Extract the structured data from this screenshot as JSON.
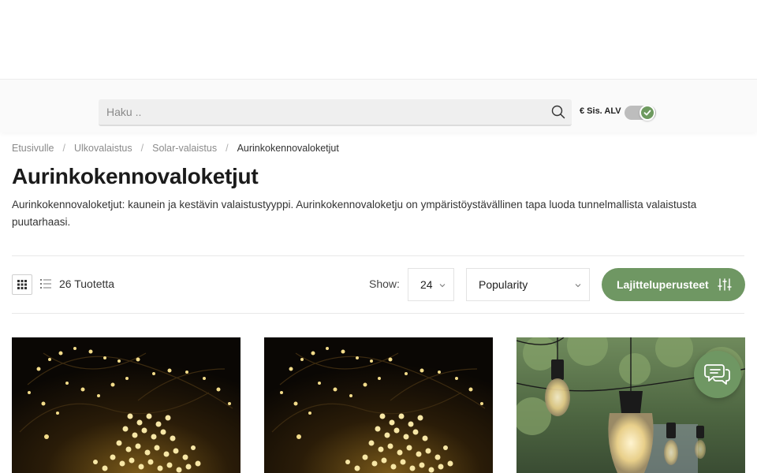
{
  "search": {
    "placeholder": "Haku .."
  },
  "vat_toggle": {
    "label": "€ Sis. ALV",
    "checked": true
  },
  "breadcrumb": {
    "items": [
      "Etusivulle",
      "Ulkovalaistus",
      "Solar-valaistus"
    ],
    "separator": "/",
    "current": "Aurinkokennovaloketjut"
  },
  "page": {
    "title": "Aurinkokennovaloketjut",
    "description": "Aurinkokennovaloketjut: kaunein ja kestävin valaistustyyppi. Aurinkokennovaloketju on ympäristöystävällinen tapa luoda tunnelmallista valaistusta puutarhaasi."
  },
  "toolbar": {
    "product_count": "26 Tuotetta",
    "show_label": "Show:",
    "show_value": "24",
    "sort_value": "Popularity",
    "filter_label": "Lajitteluperusteet"
  },
  "products": [
    {
      "image": "warm-white-solar-fairy-lights"
    },
    {
      "image": "warm-white-solar-fairy-lights"
    },
    {
      "image": "festoon-bulb-string-lights"
    }
  ],
  "colors": {
    "accent": "#6f9763",
    "toggle_knob": "#6e9a5f"
  },
  "icons": [
    "search-icon",
    "check-icon",
    "grid-view-icon",
    "list-view-icon",
    "chevron-down-icon",
    "sliders-icon",
    "chat-icon"
  ]
}
